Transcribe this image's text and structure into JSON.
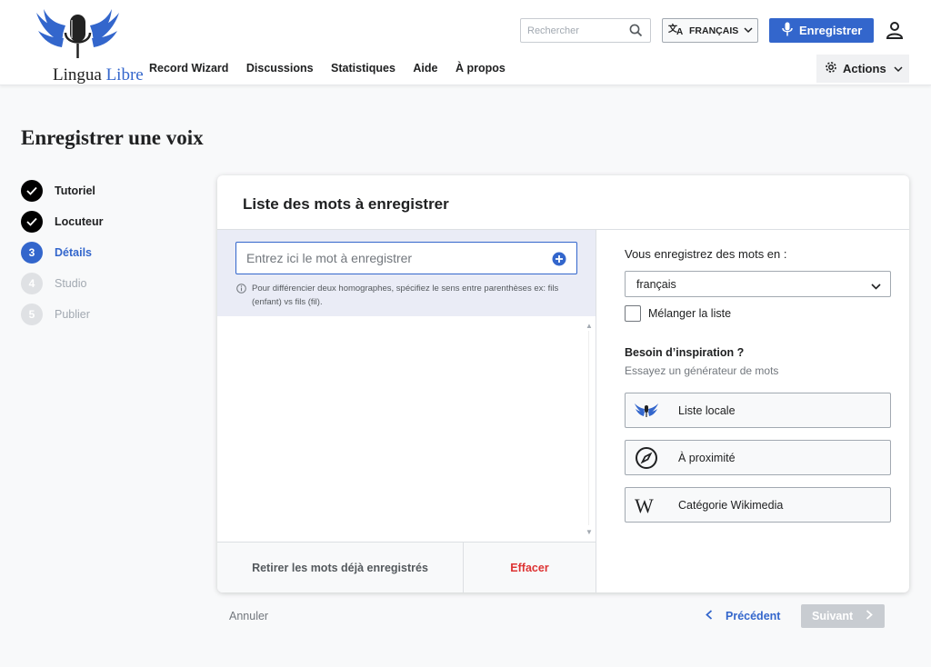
{
  "header": {
    "logo_text_part1": "Lingua",
    "logo_text_part2": "Libre",
    "nav": [
      "Record Wizard",
      "Discussions",
      "Statistiques",
      "Aide",
      "À propos"
    ],
    "search_placeholder": "Rechercher",
    "language_button": "FRANÇAIS",
    "record_button": "Enregistrer",
    "actions_button": "Actions"
  },
  "page": {
    "title": "Enregistrer une voix"
  },
  "steps": [
    {
      "number": "",
      "label": "Tutoriel",
      "state": "done"
    },
    {
      "number": "",
      "label": "Locuteur",
      "state": "done"
    },
    {
      "number": "3",
      "label": "Détails",
      "state": "active"
    },
    {
      "number": "4",
      "label": "Studio",
      "state": "todo"
    },
    {
      "number": "5",
      "label": "Publier",
      "state": "todo"
    }
  ],
  "card": {
    "title": "Liste des mots à enregistrer",
    "word_input_placeholder": "Entrez ici le mot à enregistrer",
    "hint": "Pour différencier deux homographes, spécifiez le sens entre parenthèses ex: fils (enfant) vs fils (fil).",
    "remove_recorded_button": "Retirer les mots déjà enregistrés",
    "clear_button": "Effacer",
    "language_label": "Vous enregistrez des mots en :",
    "language_value": "français",
    "shuffle_label": "Mélanger la liste",
    "inspiration_title": "Besoin d’inspiration ?",
    "inspiration_subtitle": "Essayez un générateur de mots",
    "generators": [
      {
        "label": "Liste locale",
        "icon": "lingualibre-logo-icon"
      },
      {
        "label": "À proximité",
        "icon": "compass-icon"
      },
      {
        "label": "Catégorie Wikimedia",
        "icon": "wikipedia-w-icon"
      }
    ]
  },
  "footer": {
    "cancel": "Annuler",
    "previous": "Précédent",
    "next": "Suivant"
  },
  "colors": {
    "accent": "#3366cc",
    "danger": "#d33333",
    "disabled": "#c8ccd1"
  }
}
